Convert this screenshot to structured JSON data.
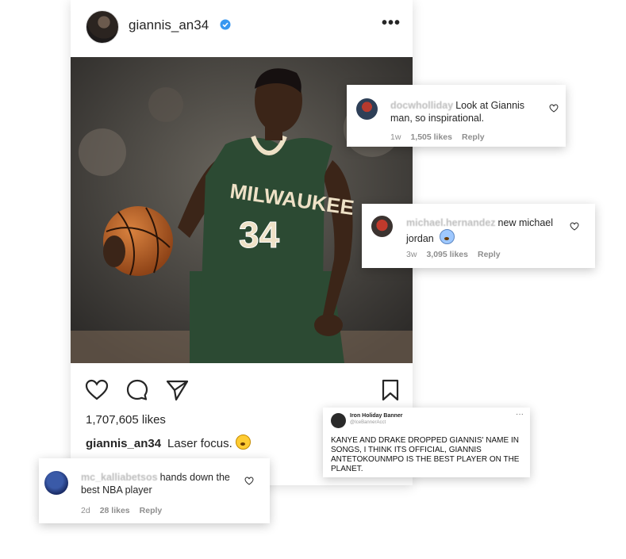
{
  "post": {
    "username": "giannis_an34",
    "more_label": "•••",
    "likes": "1,707,605 likes",
    "caption_user": "giannis_an34",
    "caption_text": "Laser focus.",
    "photo": {
      "jersey_team": "MILWAUKEE",
      "jersey_number": "34"
    }
  },
  "comments": [
    {
      "user": "docwholliday",
      "text": "Look at Giannis man, so inspirational.",
      "age": "1w",
      "likes": "1,505 likes",
      "reply": "Reply"
    },
    {
      "user": "michael.hernandez",
      "text": "new michael jordan",
      "age": "3w",
      "likes": "3,095 likes",
      "reply": "Reply"
    },
    {
      "user": "mc_kalliabetsos",
      "text": "hands down the best NBA player",
      "age": "2d",
      "likes": "28 likes",
      "reply": "Reply"
    }
  ],
  "tweet": {
    "name": "Iron Holiday Banner",
    "handle": "@IceBannerAcct",
    "more_label": "···",
    "text": "KANYE AND DRAKE DROPPED GIANNIS' NAME IN SONGS, I THINK ITS OFFICIAL, GIANNIS ANTETOKOUNMPO IS THE BEST PLAYER ON THE PLANET."
  },
  "colors": {
    "verified_blue": "#3897f0",
    "jersey_green": "#2c4a33",
    "jersey_cream": "#eee1c6"
  },
  "icons": [
    "verified-icon",
    "heart-icon",
    "comment-icon",
    "share-icon",
    "bookmark-icon",
    "heart-outline-icon"
  ]
}
